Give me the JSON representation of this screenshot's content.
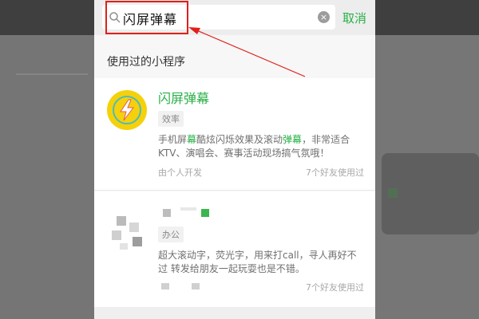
{
  "search": {
    "query": "闪屏弹幕",
    "cancel_label": "取消"
  },
  "section": {
    "title": "使用过的小程序"
  },
  "results": [
    {
      "name": "闪屏弹幕",
      "tag": "效率",
      "description_line1_parts": [
        "手机屏",
        "幕",
        "酷炫闪烁效果及滚动",
        "弹幕",
        "，非常适合"
      ],
      "description_line2": "KTV、演唱会、赛事活动现场搞气氛哦！",
      "developer": "由个人开发",
      "friends_used": "7个好友使用过",
      "icon": "lightning-icon"
    },
    {
      "tag": "办公",
      "description_line1": "超大滚动字，荧光字，用来打call，寻人再好不",
      "description_line2": "过    转发给朋友一起玩耍也是不错。",
      "friends_used": "7个好友使用过",
      "icon": "blurred-app-icon"
    }
  ],
  "colors": {
    "accent_green": "#27b046",
    "highlight_red": "#e0201a"
  }
}
